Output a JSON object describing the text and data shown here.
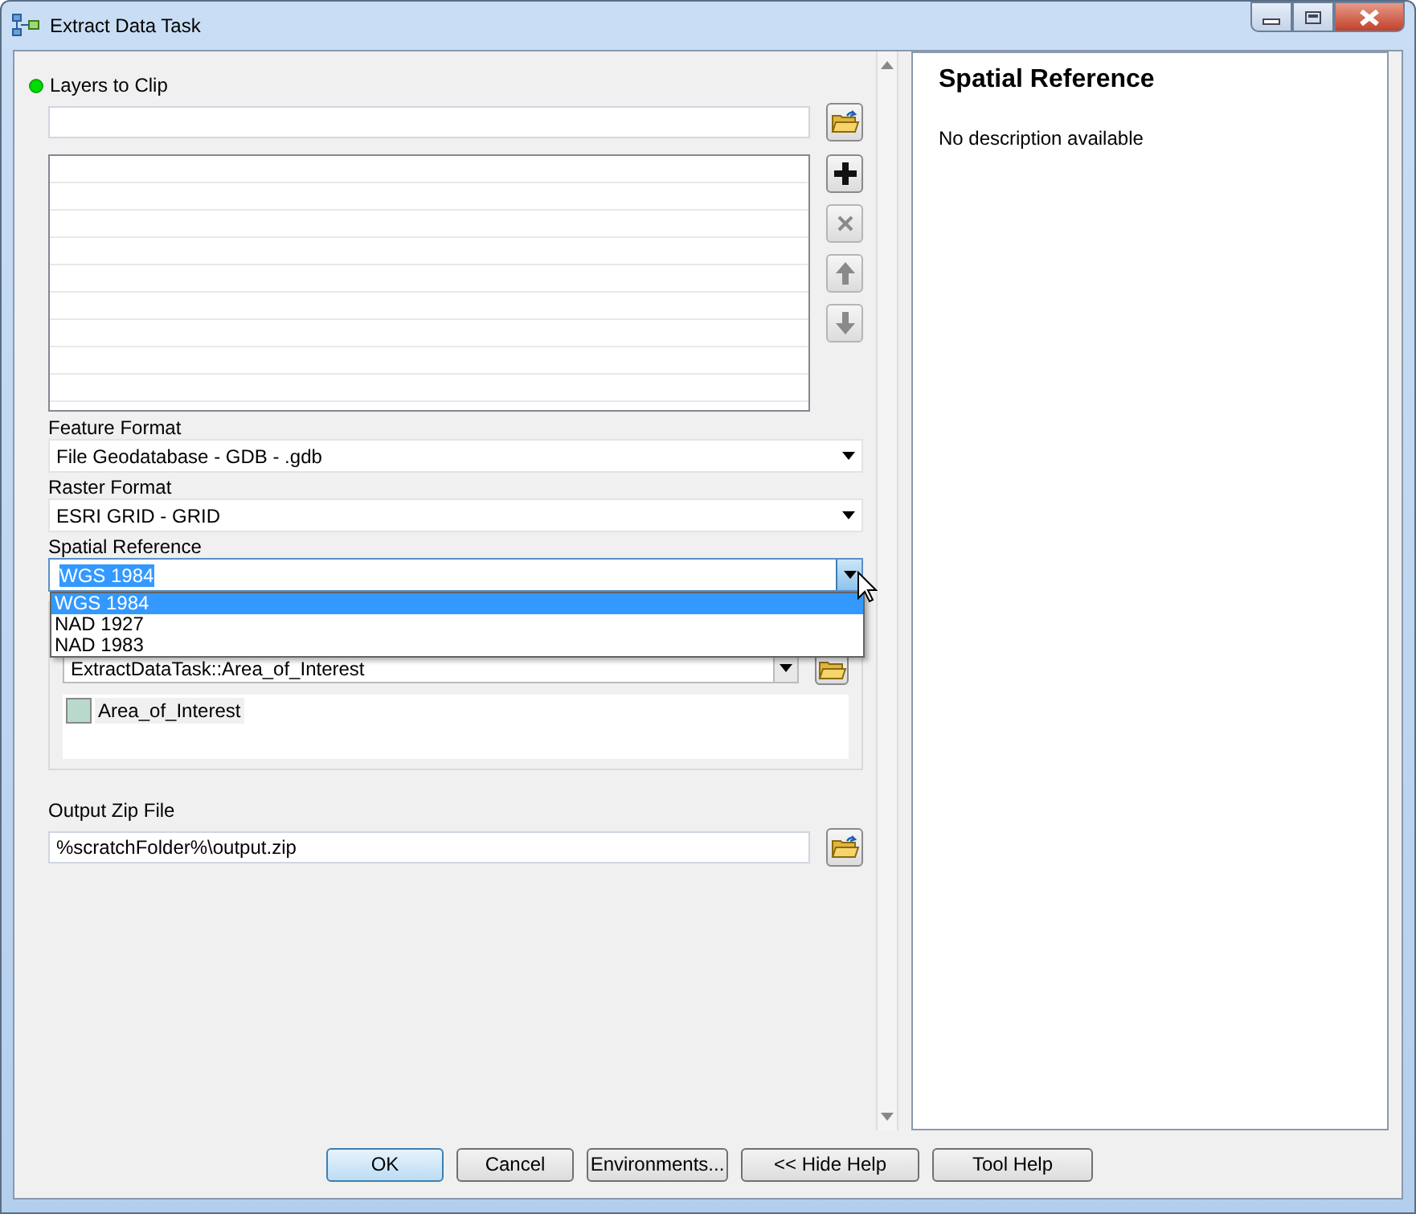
{
  "window": {
    "title": "Extract Data Task"
  },
  "layers_to_clip": {
    "label": "Layers to Clip",
    "required": true,
    "tools": [
      {
        "kind": "add",
        "disabled": false
      },
      {
        "kind": "remove",
        "disabled": true
      },
      {
        "kind": "up",
        "disabled": true
      },
      {
        "kind": "down",
        "disabled": true
      }
    ]
  },
  "feature_format": {
    "label": "Feature Format",
    "value": "File Geodatabase - GDB - .gdb"
  },
  "raster_format": {
    "label": "Raster Format",
    "value": "ESRI GRID - GRID"
  },
  "spatial_reference": {
    "label": "Spatial Reference",
    "value": "WGS 1984",
    "expanded": true,
    "options": [
      {
        "label": "WGS 1984",
        "selected": true
      },
      {
        "label": "NAD 1927",
        "selected": false
      },
      {
        "label": "NAD 1983",
        "selected": false
      }
    ]
  },
  "area_of_interest": {
    "value": "ExtractDataTask::Area_of_Interest",
    "items": [
      {
        "label": "Area_of_Interest",
        "color": "#b9d9cc"
      }
    ]
  },
  "output_zip": {
    "label": "Output Zip File",
    "value": "%scratchFolder%\\output.zip"
  },
  "help": {
    "title": "Spatial Reference",
    "text": "No description available"
  },
  "buttons": [
    {
      "label": "OK",
      "default": true
    },
    {
      "label": "Cancel",
      "default": false
    },
    {
      "label": "Environments...",
      "default": false
    },
    {
      "label": "<< Hide Help",
      "default": false
    },
    {
      "label": "Tool Help",
      "default": false
    }
  ]
}
